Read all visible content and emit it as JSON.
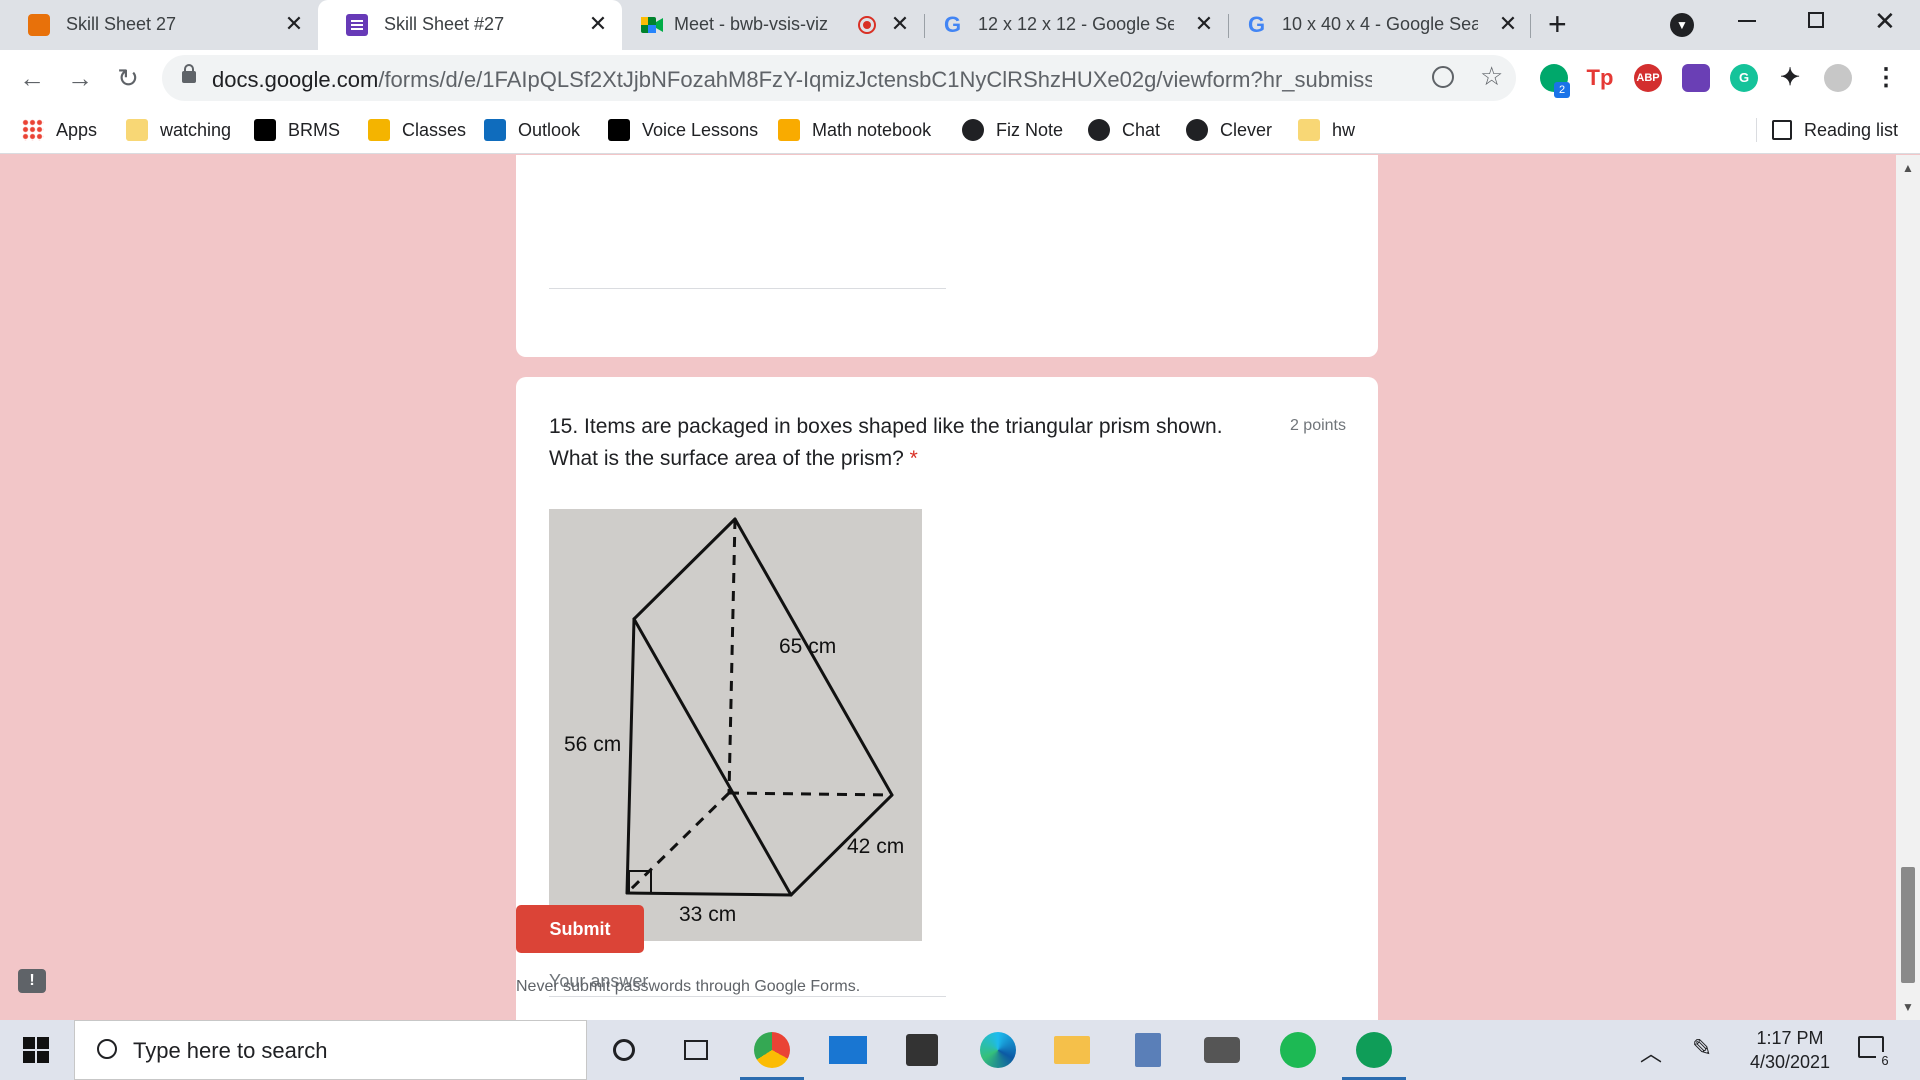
{
  "browser": {
    "tabs": [
      {
        "title": "Skill Sheet 27",
        "active": false
      },
      {
        "title": "Skill Sheet #27",
        "active": true
      },
      {
        "title": "Meet - bwb-vsis-viz",
        "active": false
      },
      {
        "title": "12 x 12 x 12 - Google Sear",
        "active": false
      },
      {
        "title": "10 x 40 x 4 - Google Searc",
        "active": false
      }
    ],
    "url_host": "docs.google.com",
    "url_path": "/forms/d/e/1FAIpQLSf2XtJjbNFozahM8FzY-IqmizJctensbC1NyClRShzHUXe02g/viewform?hr_submission=ChgI...",
    "extension_badge": "2",
    "bookmarks": [
      "Apps",
      "watching",
      "BRMS",
      "Classes",
      "Outlook",
      "Voice Lessons",
      "Math notebook",
      "Fiz Note",
      "Chat",
      "Clever",
      "hw"
    ],
    "reading_list": "Reading list"
  },
  "form": {
    "question": "15. Items are packaged in boxes shaped like the triangular prism shown. What is the surface area of the prism?",
    "required_mark": "*",
    "points": "2 points",
    "figure_labels": {
      "edge_top": "65 cm",
      "edge_height": "56 cm",
      "edge_side": "42 cm",
      "edge_base": "33 cm"
    },
    "answer_placeholder": "Your answer",
    "submit_label": "Submit",
    "notice": "Never submit passwords through Google Forms."
  },
  "taskbar": {
    "search_placeholder": "Type here to search",
    "time": "1:17 PM",
    "date": "4/30/2021",
    "notification_count": "6"
  },
  "colors": {
    "page_bg": "#f2c6c8",
    "submit": "#db4437",
    "required": "#d93025"
  }
}
